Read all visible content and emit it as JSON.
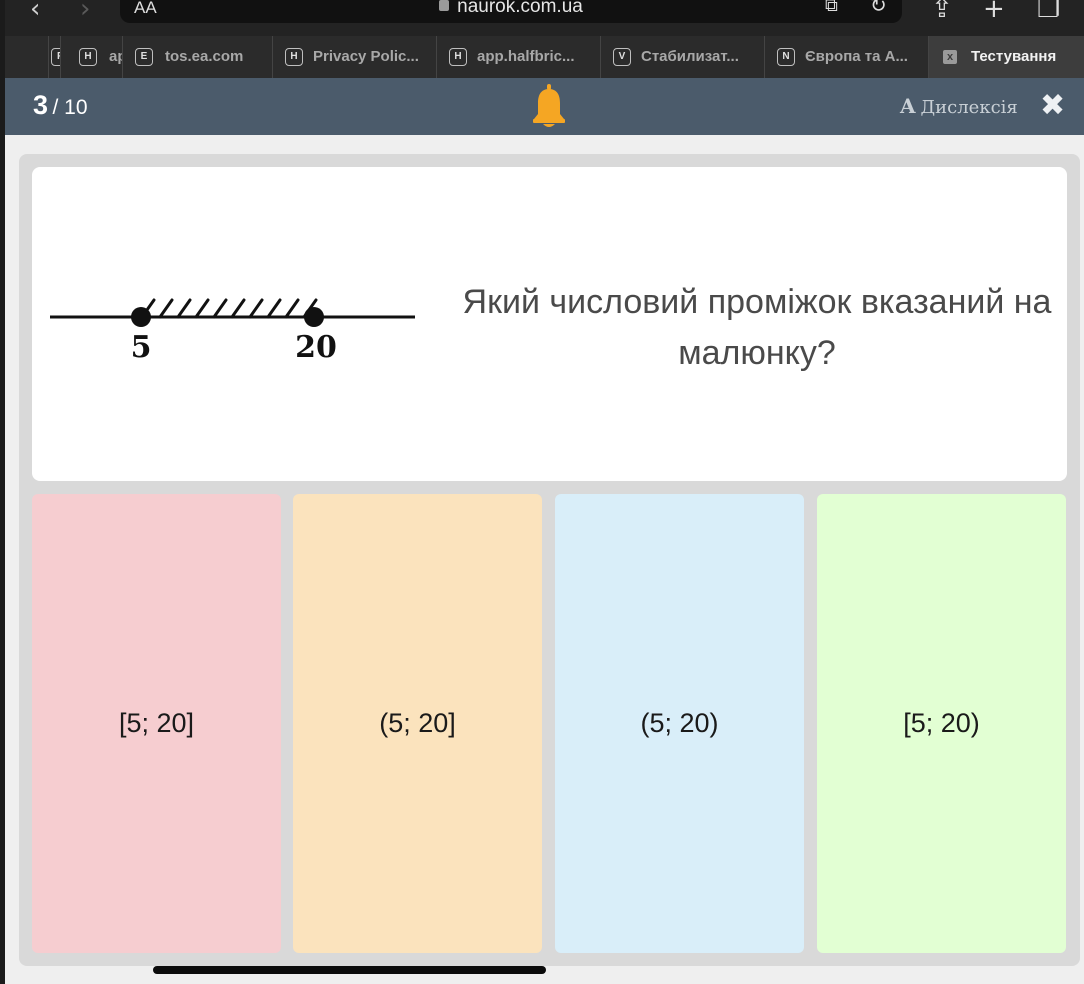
{
  "browser": {
    "text_size_label": "AA",
    "url": "naurok.com.ua"
  },
  "tabs": [
    {
      "favicon": "H",
      "label": "ap"
    },
    {
      "favicon": "E",
      "label": "tos.ea.com"
    },
    {
      "favicon": "H",
      "label": "Privacy Polic..."
    },
    {
      "favicon": "H",
      "label": "app.halfbric..."
    },
    {
      "favicon": "V",
      "label": "Стабилизат..."
    },
    {
      "favicon": "N",
      "label": "Європа та А..."
    },
    {
      "favicon": "x",
      "label": "Тестування",
      "active": true
    }
  ],
  "quiz": {
    "current": "3",
    "total": "/ 10",
    "dyslexia_icon": "A",
    "dyslexia_label": "Дислексія",
    "question": "Який числовий проміжок вказаний на малюнку?",
    "figure": {
      "left_label": "5",
      "right_label": "20"
    },
    "answers": [
      {
        "label": "[5; 20]",
        "color": "#f6cdd0"
      },
      {
        "label": "(5; 20]",
        "color": "#fbe3bd"
      },
      {
        "label": "(5; 20)",
        "color": "#d9eef9"
      },
      {
        "label": "[5; 20)",
        "color": "#e2ffd3"
      }
    ]
  },
  "colors": {
    "header_bg": "#4b5b6b",
    "bell": "#f5a623"
  }
}
